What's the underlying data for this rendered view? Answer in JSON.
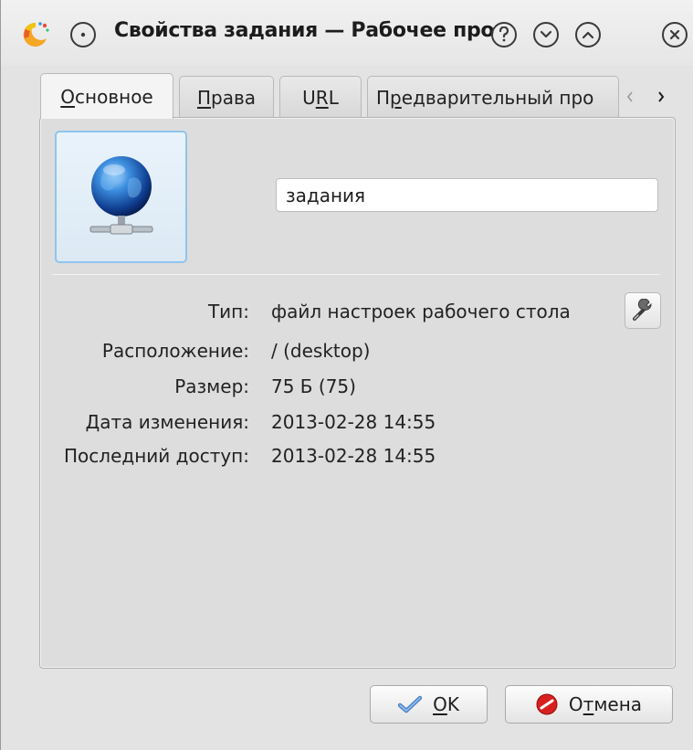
{
  "window": {
    "title": "Свойства задания — Рабочее про"
  },
  "tabs": [
    {
      "pre": "",
      "key": "О",
      "post": "сновное",
      "active": true
    },
    {
      "pre": "",
      "key": "П",
      "post": "рава",
      "active": false
    },
    {
      "pre": "U",
      "key": "R",
      "post": "L",
      "active": false
    },
    {
      "pre": "П",
      "key": "р",
      "post": "едварительный про",
      "active": false
    }
  ],
  "tab_scroll": {
    "left": "‹",
    "right": "›"
  },
  "general": {
    "name_value": "задания",
    "properties": [
      {
        "label": "Тип:",
        "value": "файл настроек рабочего стола"
      },
      {
        "label": "Расположение:",
        "value": "/ (desktop)"
      },
      {
        "label": "Размер:",
        "value": "75 Б (75)"
      },
      {
        "label": "Дата изменения:",
        "value": "2013-02-28 14:55"
      },
      {
        "label": "Последний доступ:",
        "value": "2013-02-28 14:55"
      }
    ]
  },
  "buttons": {
    "ok": {
      "key": "O",
      "rest": "K"
    },
    "cancel": {
      "pre": "О",
      "key": "т",
      "rest": "мена"
    }
  },
  "icons": {
    "app": "kde-app-icon",
    "pin": "pin-icon",
    "help": "help-icon",
    "minimize": "minimize-icon",
    "maximize": "maximize-icon",
    "close": "close-icon",
    "file": "network-globe-icon",
    "config": "wrench-icon",
    "ok": "checkmark-icon",
    "cancel": "cancel-icon"
  },
  "colors": {
    "accent": "#8ec5ee",
    "cancel_red": "#d8201f",
    "ok_blue": "#4c84c8"
  }
}
